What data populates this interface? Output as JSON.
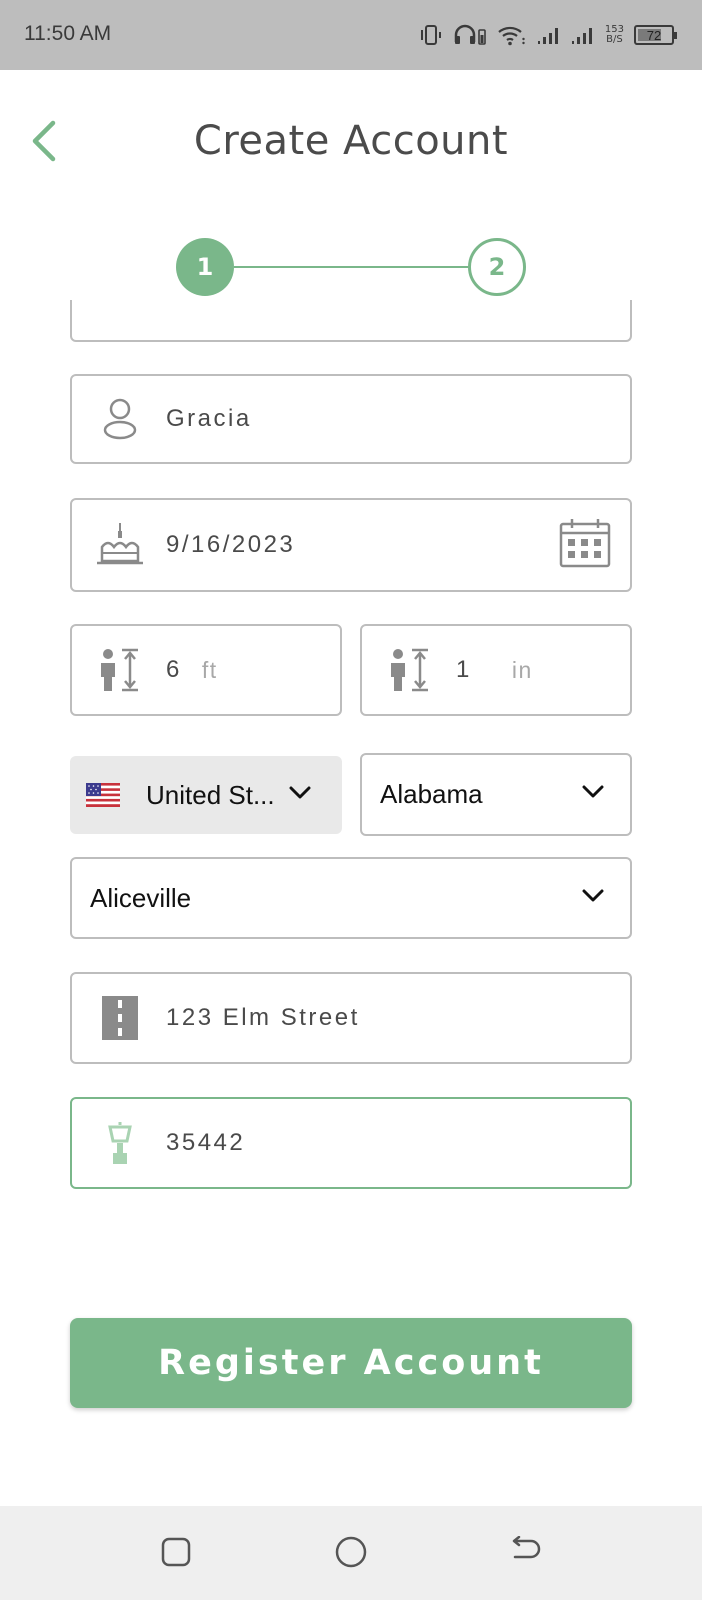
{
  "status_bar": {
    "time": "11:50 AM",
    "net_speed_value": "153",
    "net_speed_unit": "B/S",
    "battery_level": "72",
    "battery_fraction": 0.72
  },
  "header": {
    "title": "Create Account",
    "back_icon": "chevron-left-icon"
  },
  "stepper": {
    "steps": [
      {
        "label": "1",
        "state": "active"
      },
      {
        "label": "2",
        "state": "upcoming"
      }
    ]
  },
  "form": {
    "name": {
      "value": "Gracia",
      "icon": "person-icon"
    },
    "birthdate": {
      "value": "9/16/2023",
      "icon": "birthday-cake-icon",
      "trailing_icon": "calendar-icon"
    },
    "height_ft": {
      "value": "6",
      "unit": "ft",
      "icon": "height-icon"
    },
    "height_in": {
      "value": "1",
      "unit": "in",
      "icon": "height-icon"
    },
    "country": {
      "value": "United St...",
      "flag": "us-flag-icon"
    },
    "state": {
      "value": "Alabama"
    },
    "city": {
      "value": "Aliceville"
    },
    "street": {
      "value": "123 Elm Street",
      "icon": "road-icon"
    },
    "zip": {
      "value": "35442",
      "icon": "lamp-post-icon"
    }
  },
  "actions": {
    "register_label": "Register Account"
  },
  "colors": {
    "accent": "#7ab78a",
    "status_bar": "#bdbdbd",
    "border": "#bdbdbd",
    "nav_bar": "#efefef"
  }
}
